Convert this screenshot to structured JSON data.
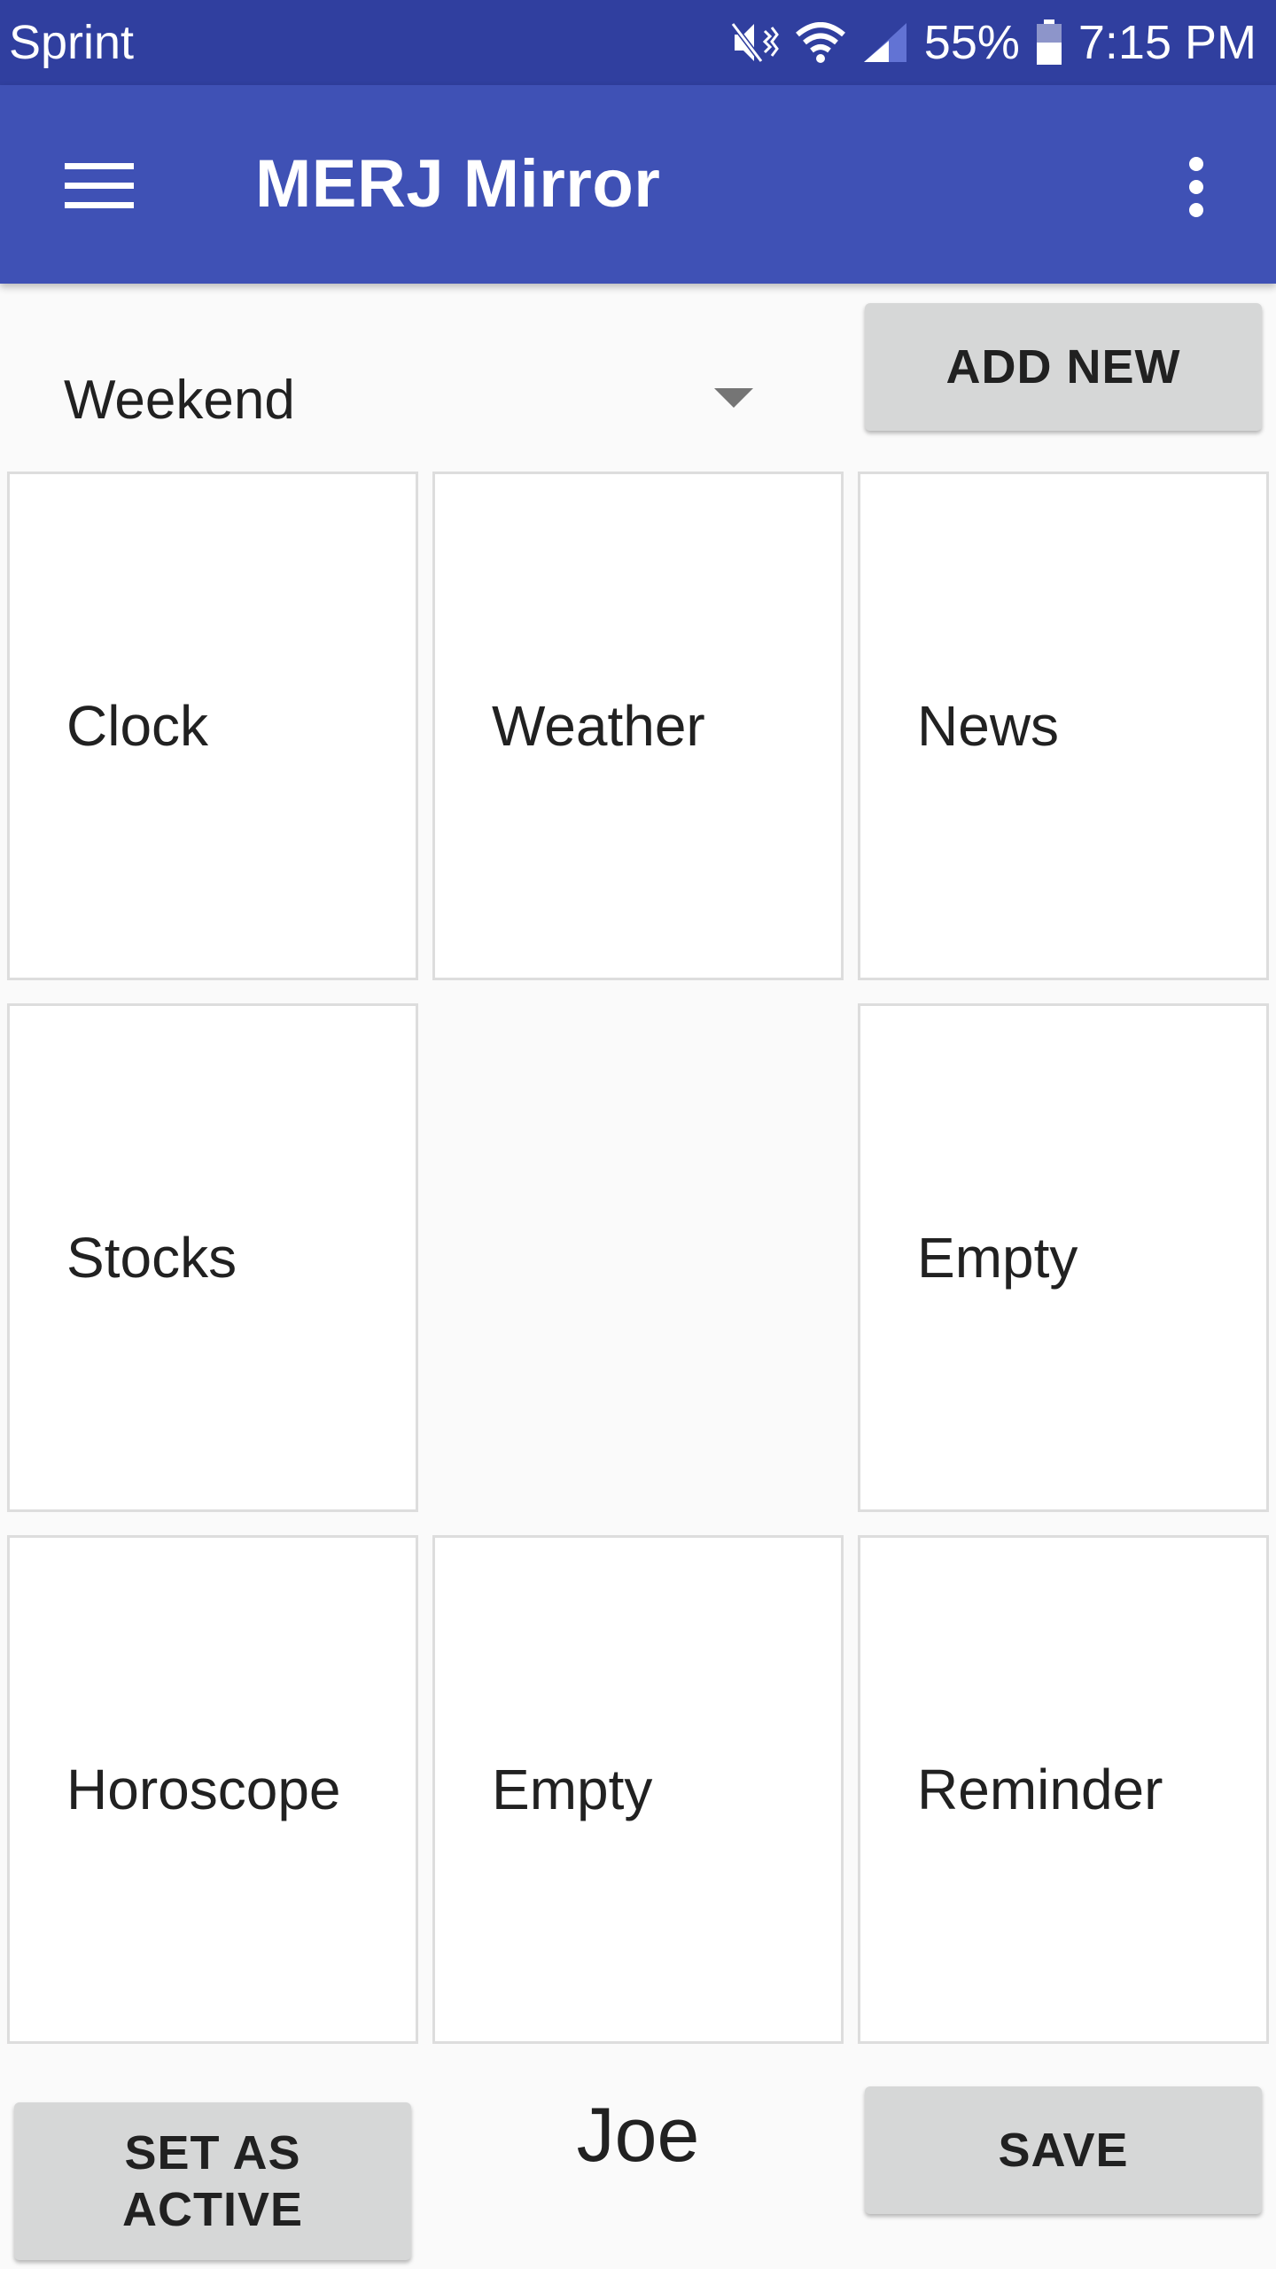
{
  "status_bar": {
    "carrier": "Sprint",
    "battery": "55%",
    "time": "7:15 PM",
    "icons": [
      "mute-vibrate-icon",
      "wifi-icon",
      "signal-icon",
      "battery-icon"
    ]
  },
  "app_bar": {
    "title": "MERJ Mirror",
    "nav_icon": "hamburger-menu-icon",
    "overflow_icon": "more-vert-icon",
    "color": "#3f51b5",
    "status_color": "#303f9f"
  },
  "layout_select": {
    "selected": "Weekend"
  },
  "buttons": {
    "add_new": "ADD NEW",
    "set_active": "SET AS ACTIVE",
    "save": "SAVE"
  },
  "grid": {
    "tiles": [
      "Clock",
      "Weather",
      "News",
      "Stocks",
      "",
      "Empty",
      "Horoscope",
      "Empty",
      "Reminder"
    ]
  },
  "profile": {
    "name": "Joe"
  }
}
